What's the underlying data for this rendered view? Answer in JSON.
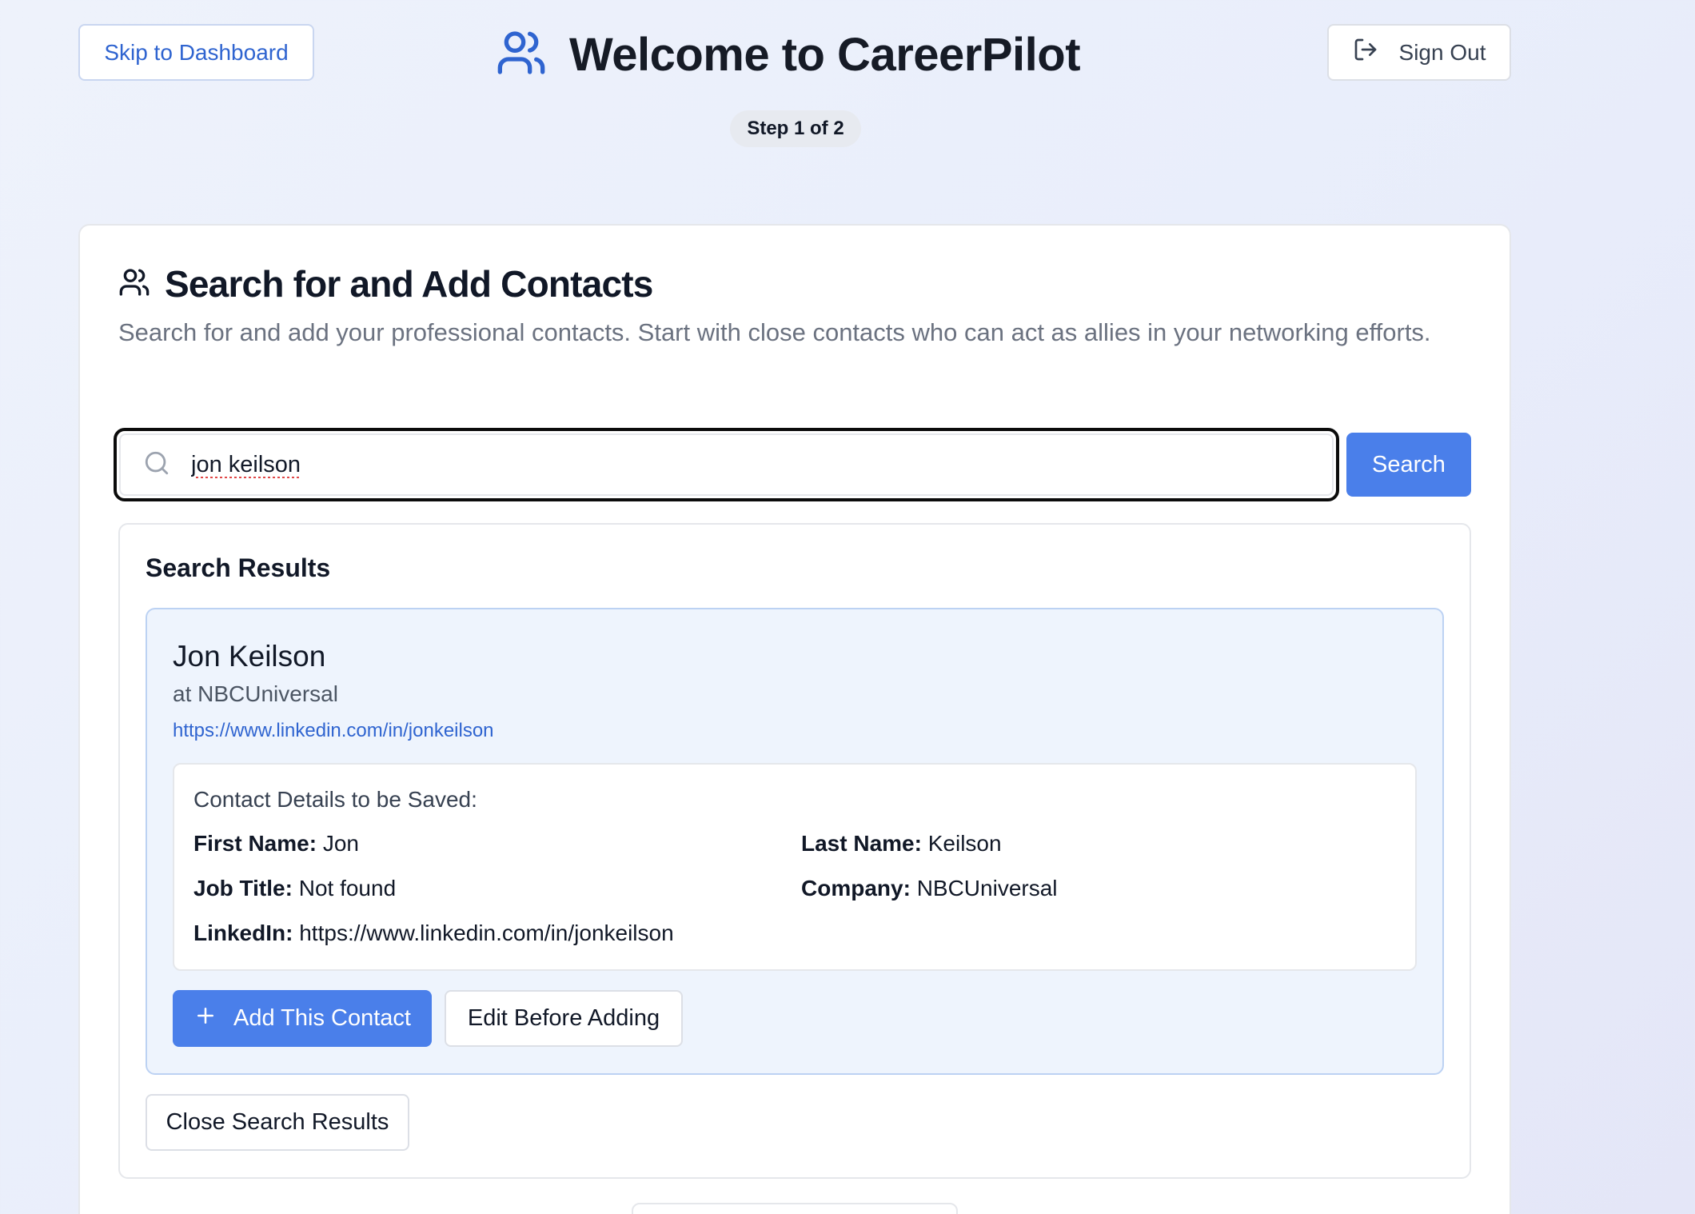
{
  "header": {
    "skip_label": "Skip to Dashboard",
    "title": "Welcome to CareerPilot",
    "step": "Step 1 of 2",
    "signout_label": "Sign Out",
    "brand_icon": "users-icon",
    "accent_color": "#4a7fea"
  },
  "section": {
    "title": "Search for and Add Contacts",
    "description": "Search for and add your professional contacts. Start with close contacts who can act as allies in your networking efforts."
  },
  "search": {
    "value": "jon keilson",
    "button_label": "Search"
  },
  "results": {
    "title": "Search Results",
    "contact": {
      "name": "Jon Keilson",
      "company_line": "at NBCUniversal",
      "url": "https://www.linkedin.com/in/jonkeilson"
    },
    "details": {
      "title": "Contact Details to be Saved:",
      "first_name_label": "First Name:",
      "first_name": "Jon",
      "last_name_label": "Last Name:",
      "last_name": "Keilson",
      "job_title_label": "Job Title:",
      "job_title": "Not found",
      "company_label": "Company:",
      "company": "NBCUniversal",
      "linkedin_label": "LinkedIn:",
      "linkedin": "https://www.linkedin.com/in/jonkeilson"
    },
    "add_label": "Add This Contact",
    "edit_label": "Edit Before Adding",
    "close_label": "Close Search Results"
  }
}
